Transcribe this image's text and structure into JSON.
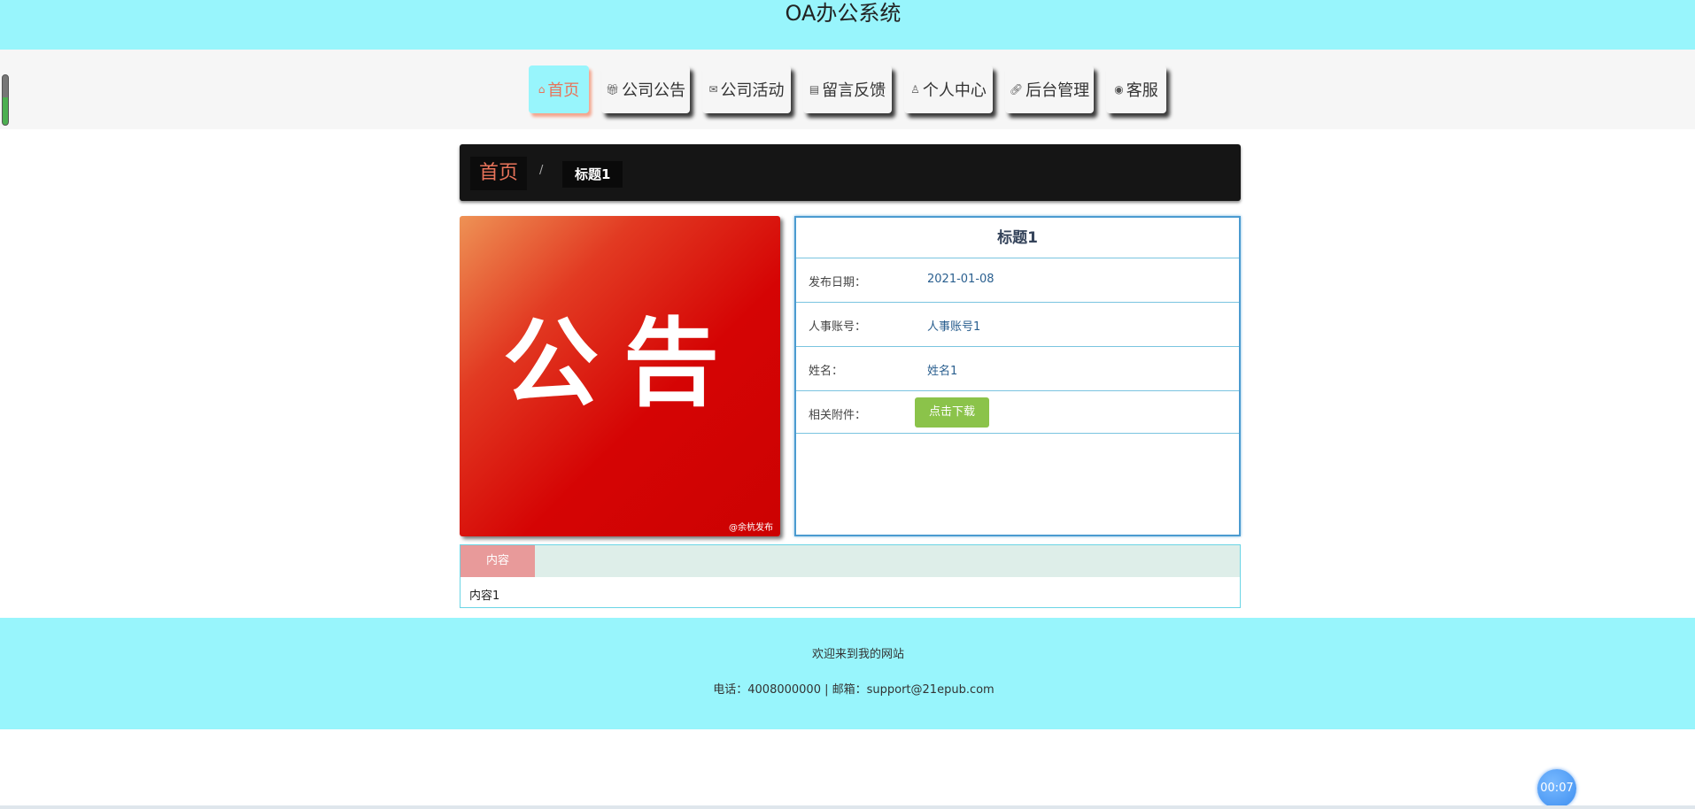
{
  "header": {
    "title": "OA办公系统",
    "bg_color": "#98f5fc"
  },
  "nav": {
    "items": [
      {
        "label": "首页",
        "icon": "home-icon",
        "active": true
      },
      {
        "label": "公司公告",
        "icon": "gift-icon"
      },
      {
        "label": "公司活动",
        "icon": "mail-icon"
      },
      {
        "label": "留言反馈",
        "icon": "calendar-icon"
      },
      {
        "label": "个人中心",
        "icon": "user-icon"
      },
      {
        "label": "后台管理",
        "icon": "link-icon"
      },
      {
        "label": "客服",
        "icon": "support-icon"
      }
    ],
    "active_color": "#e8735a"
  },
  "breadcrumb": {
    "home": "首页",
    "separator": "/",
    "current": "标题1"
  },
  "poster": {
    "text": "公告",
    "watermark": "@余杭发布"
  },
  "detail": {
    "title": "标题1",
    "rows": [
      {
        "label": "发布日期：",
        "value": "2021-01-08"
      },
      {
        "label": "人事账号：",
        "value": "人事账号1"
      },
      {
        "label": "姓名：",
        "value": "姓名1"
      }
    ],
    "attachment_label": "相关附件：",
    "download_label": "点击下载"
  },
  "content": {
    "tab_label": "内容",
    "text": "内容1"
  },
  "footer": {
    "welcome": "欢迎来到我的网站",
    "contact": "电话：4008000000 | 邮箱：support@21epub.com"
  },
  "timer": {
    "value": "00:07"
  }
}
